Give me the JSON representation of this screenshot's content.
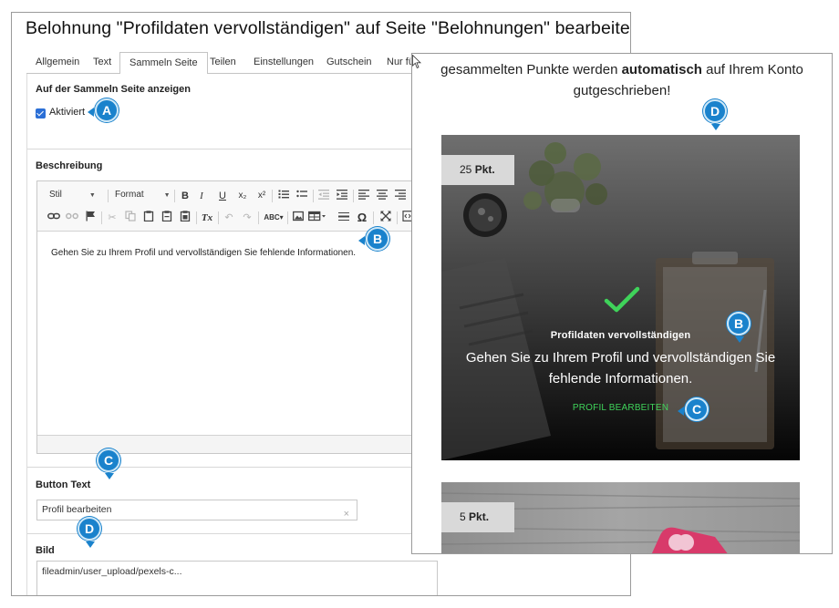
{
  "editor": {
    "title": "Belohnung \"Profildaten vervollständigen\" auf Seite \"Belohnungen\" bearbeiten",
    "tabs": [
      {
        "label": "Allgemein",
        "active": false
      },
      {
        "label": "Text",
        "active": false
      },
      {
        "label": "Sammeln Seite",
        "active": true
      },
      {
        "label": "Teilen",
        "active": false
      },
      {
        "label": "Einstellungen",
        "active": false
      },
      {
        "label": "Gutschein",
        "active": false
      },
      {
        "label": "Nur für",
        "active": false
      }
    ],
    "show_section": {
      "label": "Auf der Sammeln Seite anzeigen",
      "checkbox_label": "Aktiviert",
      "checked": true
    },
    "description": {
      "label": "Beschreibung",
      "toolbar": {
        "style_select": "Stil",
        "format_select": "Format",
        "bold": "B",
        "italic": "I",
        "underline": "U",
        "subscript": "x₂",
        "superscript": "x²",
        "clear_format": "Tx",
        "omega": "Ω"
      },
      "content": "Gehen Sie zu Ihrem Profil und vervollständigen Sie fehlende Informationen."
    },
    "button_text": {
      "label": "Button Text",
      "value": "Profil bearbeiten",
      "clear_symbol": "×"
    },
    "image": {
      "label": "Bild",
      "value": "fileadmin/user_upload/pexels-c..."
    }
  },
  "preview": {
    "intro_line1": "gesammelten Punkte werden ",
    "intro_bold": "automatisch",
    "intro_line1_end": " auf Ihrem Konto",
    "intro_line2": "gutgeschrieben!",
    "card1": {
      "points_value": "25",
      "points_unit": "Pkt.",
      "title": "Profildaten vervollständigen",
      "description": "Gehen Sie zu Ihrem Profil und vervollständigen Sie fehlende Informationen.",
      "link": "PROFIL BEARBEITEN"
    },
    "card2": {
      "points_value": "5",
      "points_unit": "Pkt."
    }
  },
  "markers": {
    "a": "A",
    "b": "B",
    "c": "C",
    "d": "D"
  },
  "colors": {
    "marker_blue": "#1a82cc",
    "link_green": "#3fd35a",
    "checkbox_blue": "#2b6fd6"
  }
}
